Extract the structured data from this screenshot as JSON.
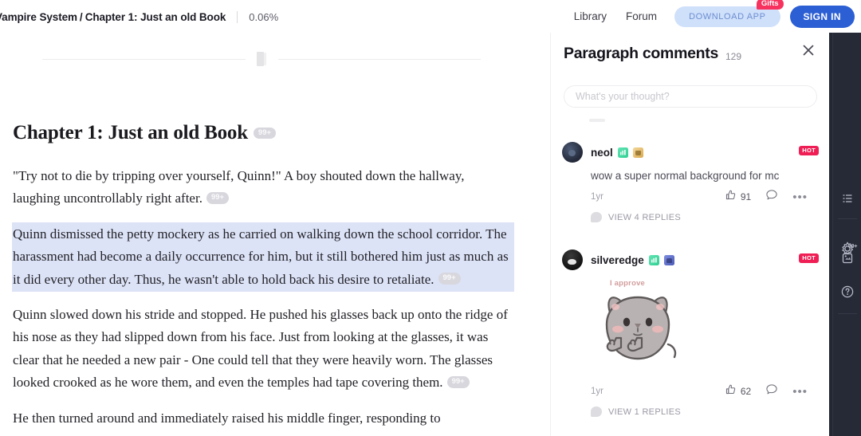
{
  "header": {
    "breadcrumb": {
      "book": "Vampire System",
      "separator": "/",
      "chapter": "Chapter 1: Just an old Book",
      "progress": "0.06%"
    },
    "nav": [
      {
        "label": "Library",
        "name": "nav-library"
      },
      {
        "label": "Forum",
        "name": "nav-forum"
      }
    ],
    "download_label": "DOWNLOAD APP",
    "gifts_badge": "Gifts",
    "signin_label": "SIGN IN"
  },
  "reader": {
    "chapter_title": "Chapter 1: Just an old Book",
    "chapter_title_badge": "99+",
    "paragraphs": [
      {
        "text": "\"Try not to die by tripping over yourself, Quinn!\" A boy shouted down the hallway, laughing uncontrollably right after.",
        "badge": "99+",
        "highlighted": false
      },
      {
        "text": "Quinn dismissed the petty mockery as he carried on walking down the school corridor. The harassment had become a daily occurrence for him, but it still bothered him just as much as it did every other day. Thus, he wasn't able to hold back his desire to retaliate.",
        "badge": "99+",
        "highlighted": true
      },
      {
        "text": "Quinn slowed down his stride and stopped. He pushed his glasses back up onto the ridge of his nose as they had slipped down from his face. Just from looking at the glasses, it was clear that he needed a new pair - One could tell that they were heavily worn. The glasses looked crooked as he wore them, and even the temples had tape covering them.",
        "badge": "99+",
        "highlighted": false
      },
      {
        "text": "He then turned around and immediately raised his middle finger, responding to",
        "badge": "",
        "highlighted": false
      }
    ]
  },
  "comments_panel": {
    "title": "Paragraph comments",
    "count": "129",
    "input_placeholder": "What's your thought?",
    "input_value": "",
    "comments": [
      {
        "username": "neol",
        "badges": [
          "green",
          "gold"
        ],
        "hot_badge": "HOT",
        "text": "wow a super normal background for mc",
        "time": "1yr",
        "likes": "91",
        "replies_label": "VIEW 4 REPLIES",
        "sticker": null
      },
      {
        "username": "silveredge",
        "badges": [
          "green",
          "blue"
        ],
        "hot_badge": "HOT",
        "text": "",
        "time": "1yr",
        "likes": "62",
        "replies_label": "VIEW 1 REPLIES",
        "sticker": {
          "caption": "I approve"
        }
      }
    ]
  },
  "rail": {
    "items": [
      {
        "name": "chapter-list-icon"
      },
      {
        "name": "settings-gear-icon"
      },
      {
        "name": "comments-note-icon",
        "badge": "99+"
      },
      {
        "name": "help-circle-icon"
      }
    ]
  },
  "colors": {
    "accent_blue": "#2c5fd4",
    "download_bg": "#cfe0fb",
    "gifts_red": "#f8325e",
    "hot_red": "#ef1f55",
    "highlight": "#dde3f7",
    "rail_bg": "#262a36"
  }
}
